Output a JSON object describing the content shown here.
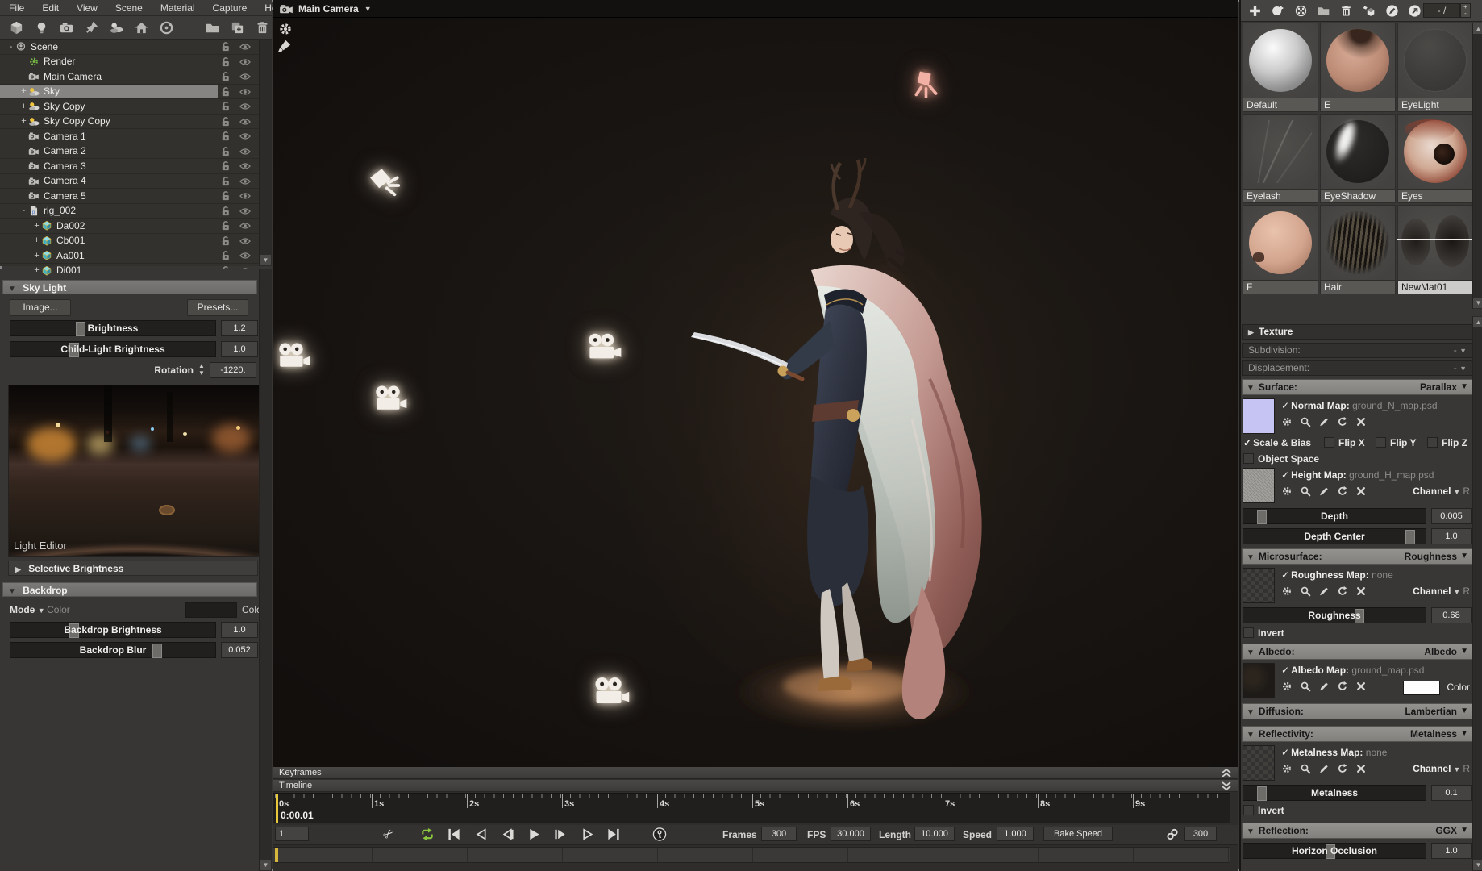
{
  "menu": {
    "items": [
      "File",
      "Edit",
      "View",
      "Scene",
      "Material",
      "Capture",
      "Help"
    ]
  },
  "left_toolbar": {
    "icons": [
      "cube-icon",
      "light-icon",
      "camera-icon",
      "pin-icon",
      "sky-icon",
      "house-icon",
      "turntable-icon",
      "folder-icon",
      "duplicate-icon",
      "trash-icon"
    ]
  },
  "scene_tree": {
    "items": [
      {
        "label": "Scene",
        "icon": "scene",
        "depth": 0,
        "expand": "-",
        "selected": false
      },
      {
        "label": "Render",
        "icon": "gear",
        "depth": 1,
        "expand": "",
        "selected": false
      },
      {
        "label": "Main Camera",
        "icon": "camera",
        "depth": 1,
        "expand": "",
        "selected": false
      },
      {
        "label": "Sky",
        "icon": "sky",
        "depth": 1,
        "expand": "+",
        "selected": true
      },
      {
        "label": "Sky Copy",
        "icon": "sky",
        "depth": 1,
        "expand": "+",
        "selected": false
      },
      {
        "label": "Sky Copy Copy",
        "icon": "sky",
        "depth": 1,
        "expand": "+",
        "selected": false
      },
      {
        "label": "Camera 1",
        "icon": "camera",
        "depth": 1,
        "expand": "",
        "selected": false
      },
      {
        "label": "Camera 2",
        "icon": "camera",
        "depth": 1,
        "expand": "",
        "selected": false
      },
      {
        "label": "Camera 3",
        "icon": "camera",
        "depth": 1,
        "expand": "",
        "selected": false
      },
      {
        "label": "Camera 4",
        "icon": "camera",
        "depth": 1,
        "expand": "",
        "selected": false
      },
      {
        "label": "Camera 5",
        "icon": "camera",
        "depth": 1,
        "expand": "",
        "selected": false
      },
      {
        "label": "rig_002",
        "icon": "page",
        "depth": 1,
        "expand": "-",
        "selected": false
      },
      {
        "label": "Da002",
        "icon": "cube",
        "depth": 2,
        "expand": "+",
        "selected": false
      },
      {
        "label": "Cb001",
        "icon": "cube",
        "depth": 2,
        "expand": "+",
        "selected": false
      },
      {
        "label": "Aa001",
        "icon": "cube",
        "depth": 2,
        "expand": "+",
        "selected": false
      },
      {
        "label": "Di001",
        "icon": "cube",
        "depth": 2,
        "expand": "+",
        "selected": false
      }
    ]
  },
  "sky_light": {
    "title": "Sky Light",
    "image_button": "Image...",
    "presets_button": "Presets...",
    "brightness": {
      "label": "Brightness",
      "value": "1.2",
      "pos": 0.33
    },
    "child_brightness": {
      "label": "Child-Light Brightness",
      "value": "1.0",
      "pos": 0.3
    },
    "rotation_label": "Rotation",
    "rotation_value": "-1220.",
    "light_editor_label": "Light Editor",
    "selective_brightness_label": "Selective Brightness"
  },
  "backdrop": {
    "title": "Backdrop",
    "mode_label": "Mode",
    "mode_value": "Color",
    "color_label": "Color",
    "brightness": {
      "label": "Backdrop Brightness",
      "value": "1.0",
      "pos": 0.3
    },
    "blur": {
      "label": "Backdrop Blur",
      "value": "0.052",
      "pos": 0.72
    }
  },
  "viewport": {
    "camera_selector": "Main Camera"
  },
  "material_library": {
    "toolbar_icons": [
      "add-icon",
      "sphere-add-icon",
      "checker-sphere-icon",
      "folder-icon",
      "trash-icon",
      "cube-material-icon",
      "pencil-circle-icon",
      "launch-circle-icon"
    ],
    "count_field": "- /",
    "items": [
      {
        "name": "Default",
        "style": "default",
        "selected": false
      },
      {
        "name": "E",
        "style": "skin",
        "selected": false
      },
      {
        "name": "EyeLight",
        "style": "darksphere",
        "selected": false
      },
      {
        "name": "Eyelash",
        "style": "lash",
        "selected": false
      },
      {
        "name": "EyeShadow",
        "style": "swoosh",
        "selected": false
      },
      {
        "name": "Eyes",
        "style": "eye",
        "selected": false
      },
      {
        "name": "F",
        "style": "skin2",
        "selected": false
      },
      {
        "name": "Hair",
        "style": "hair",
        "selected": false
      },
      {
        "name": "NewMat01",
        "style": "speckle",
        "selected": true
      }
    ]
  },
  "material_editor": {
    "texture_label": "Texture",
    "subdivision": {
      "label": "Subdivision:",
      "value": "-"
    },
    "displacement": {
      "label": "Displacement:",
      "value": "-"
    },
    "surface": {
      "label": "Surface:",
      "mode": "Parallax",
      "normal_map": {
        "label": "Normal Map:",
        "file": "ground_N_map.psd"
      },
      "scale_bias_label": "Scale & Bias",
      "flip_x": "Flip X",
      "flip_y": "Flip Y",
      "flip_z": "Flip Z",
      "object_space_label": "Object Space",
      "height_map": {
        "label": "Height Map:",
        "file": "ground_H_map.psd"
      },
      "channel_label": "Channel",
      "channel_value": "R",
      "depth": {
        "label": "Depth",
        "value": "0.005",
        "pos": 0.08
      },
      "depth_center": {
        "label": "Depth Center",
        "value": "1.0",
        "pos": 0.93
      }
    },
    "microsurface": {
      "label": "Microsurface:",
      "mode": "Roughness",
      "map": {
        "label": "Roughness Map:",
        "file": "none"
      },
      "channel_label": "Channel",
      "channel_value": "R",
      "slider": {
        "label": "Roughness",
        "value": "0.68",
        "pos": 0.64
      },
      "invert_label": "Invert"
    },
    "albedo": {
      "label": "Albedo:",
      "mode": "Albedo",
      "map": {
        "label": "Albedo Map:",
        "file": "ground_map.psd"
      },
      "color_label": "Color"
    },
    "diffusion": {
      "label": "Diffusion:",
      "mode": "Lambertian"
    },
    "reflectivity": {
      "label": "Reflectivity:",
      "mode": "Metalness",
      "map": {
        "label": "Metalness Map:",
        "file": "none"
      },
      "channel_label": "Channel",
      "channel_value": "R",
      "slider": {
        "label": "Metalness",
        "value": "0.1",
        "pos": 0.08
      },
      "invert_label": "Invert"
    },
    "reflection": {
      "label": "Reflection:",
      "mode": "GGX",
      "slider": {
        "label": "Horizon Occlusion",
        "value": "1.0",
        "pos": 0.47
      }
    }
  },
  "timeline": {
    "keyframes_label": "Keyframes",
    "timeline_label": "Timeline",
    "ruler_ticks": [
      "0s",
      "1s",
      "2s",
      "3s",
      "4s",
      "5s",
      "6s",
      "7s",
      "8s",
      "9s"
    ],
    "current_time": "0:00.01",
    "frame_field": "1",
    "transport": [
      "loop",
      "skip-start",
      "reverse-play",
      "step-back",
      "play",
      "step-forward",
      "play-outline",
      "skip-end"
    ],
    "frames_label": "Frames",
    "frames_value": "300",
    "fps_label": "FPS",
    "fps_value": "30.000",
    "length_label": "Length",
    "length_value": "10.000",
    "speed_label": "Speed",
    "speed_value": "1.000",
    "bake_speed_label": "Bake Speed",
    "end_frame_value": "300"
  }
}
